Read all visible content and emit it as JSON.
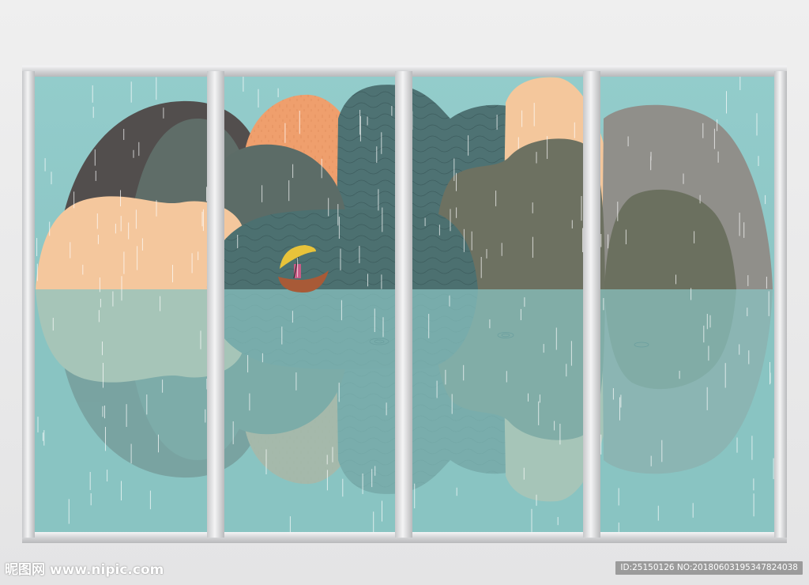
{
  "watermark": {
    "site": "昵图网 www.nipic.com"
  },
  "badge": {
    "id_text": "ID:25150126 NO:20180603195347824038"
  },
  "colors": {
    "water": "#8fc8c6",
    "sky": "#8fcac9",
    "frame": "#d9d9db",
    "peach": "#f3c59c",
    "orange": "#f0a474",
    "teal_dark": "#4f7475",
    "slate": "#5e6a64",
    "olive": "#6c7160",
    "grey_hill": "#8f8e89",
    "charcoal": "#514d4c",
    "umbrella": "#e8c33a",
    "boat": "#a85a37"
  },
  "panels": [
    {
      "name": "panel-1"
    },
    {
      "name": "panel-2"
    },
    {
      "name": "panel-3"
    },
    {
      "name": "panel-4"
    }
  ]
}
